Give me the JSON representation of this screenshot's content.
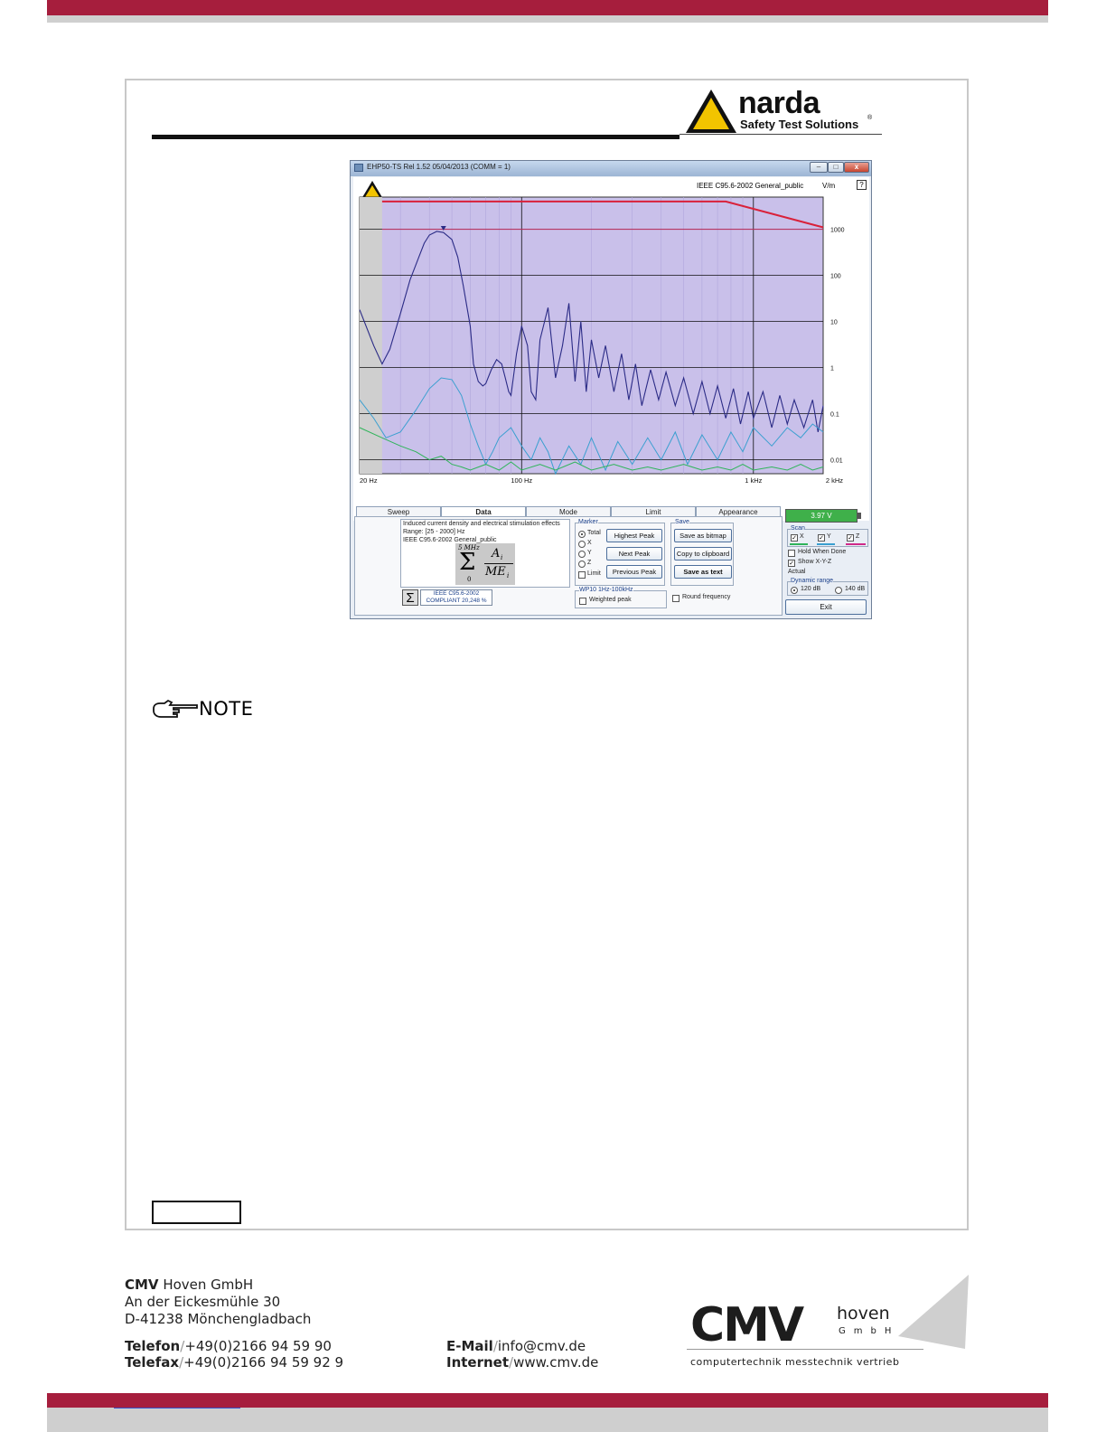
{
  "logo": {
    "brand": "narda",
    "tagline": "Safety Test Solutions",
    "registered": "®"
  },
  "app": {
    "title": "EHP50-TS Rel 1.52 05/04/2013 (COMM = 1)",
    "standard_label": "IEEE C95.6-2002 General_public",
    "unit": "V/m",
    "help": "?",
    "window_buttons": {
      "minimize": "–",
      "maximize": "□",
      "close": "x"
    },
    "tabs": [
      "Sweep",
      "Data",
      "Mode",
      "Limit",
      "Appearance"
    ],
    "active_tab": "Data",
    "battery": "3.97 V",
    "info": {
      "line1": "Induced current density and electrical stimulation effects",
      "line2": "Range: [25 - 2000] Hz",
      "line3": "IEEE C95.6-2002 General_public",
      "formula_sup": "5 MHz",
      "formula_sub": "0",
      "formula_num": "A",
      "formula_num_sub": "i",
      "formula_den": "ME",
      "formula_den_sub": "i",
      "sigma": "Σ",
      "compliance_line1": "IEEE C95.6-2002",
      "compliance_line2": "COMPLIANT 20,248 %"
    },
    "marker": {
      "title": "Marker",
      "options": [
        "Total",
        "X",
        "Y",
        "Z"
      ],
      "selected": "Total",
      "limit": "Limit",
      "buttons": [
        "Highest Peak",
        "Next Peak",
        "Previous Peak"
      ]
    },
    "save": {
      "title": "Save",
      "buttons": [
        "Save as bitmap",
        "Copy to clipboard",
        "Save as text"
      ]
    },
    "wp": {
      "title": "WP10 1Hz-100kHz",
      "weighted": "Weighted peak"
    },
    "round_frequency": "Round frequency",
    "scan": {
      "title": "Scan",
      "axes": [
        "X",
        "Y",
        "Z"
      ]
    },
    "hold_when_done": "Hold When Done",
    "show_xyz": "Show X-Y-Z",
    "actual": "Actual",
    "dynamic_range": {
      "title": "Dynamic range",
      "options": [
        "120 dB",
        "140 dB"
      ],
      "selected": "120 dB"
    },
    "exit": "Exit"
  },
  "chart_data": {
    "type": "line",
    "title": "IEEE C95.6-2002 General_public",
    "xlabel": "",
    "ylabel": "V/m",
    "x_scale": "log",
    "y_scale": "log",
    "xlim": [
      20,
      2000
    ],
    "ylim": [
      0.005,
      5000
    ],
    "x_ticks": [
      "20 Hz",
      "100 Hz",
      "1 kHz",
      "2 kHz"
    ],
    "y_ticks": [
      "1000",
      "100",
      "10",
      "1",
      "0.1",
      "0.01"
    ],
    "grid": true,
    "colors": {
      "total": "#2b2b86",
      "x": "#3a9fd0",
      "y": "#2fb45a",
      "limit": "#d9213a",
      "marker": "#2b2b86",
      "background": "#c9c0ea"
    },
    "series": [
      {
        "x": [
          20,
          23,
          25,
          27,
          30,
          33,
          36,
          38,
          40,
          43,
          46,
          50,
          53,
          56,
          60,
          62,
          65,
          68,
          70,
          74,
          78,
          82,
          85,
          88,
          90,
          95,
          100,
          106,
          110,
          115,
          120,
          130,
          140,
          150,
          160,
          170,
          180,
          190,
          200,
          215,
          230,
          250,
          270,
          290,
          310,
          330,
          360,
          390,
          420,
          460,
          500,
          550,
          600,
          650,
          700,
          760,
          820,
          880,
          950,
          1000,
          1100,
          1200,
          1300,
          1400,
          1500,
          1650,
          1800,
          1900,
          2000
        ],
        "values": [
          18,
          3,
          1.2,
          2.5,
          15,
          80,
          250,
          500,
          750,
          900,
          850,
          600,
          250,
          60,
          8,
          1.2,
          0.5,
          0.4,
          0.45,
          0.9,
          1.5,
          1.2,
          0.6,
          0.3,
          0.25,
          2,
          8,
          3,
          0.3,
          0.2,
          4,
          20,
          0.6,
          3,
          25,
          0.5,
          10,
          0.3,
          4,
          0.6,
          3,
          0.3,
          2,
          0.2,
          1.2,
          0.15,
          0.9,
          0.2,
          0.8,
          0.15,
          0.6,
          0.1,
          0.5,
          0.1,
          0.4,
          0.08,
          0.35,
          0.06,
          0.3,
          0.08,
          0.3,
          0.05,
          0.25,
          0.06,
          0.2,
          0.05,
          0.2,
          0.04,
          0.15
        ]
      },
      {
        "x": [
          20,
          23,
          26,
          30,
          35,
          40,
          45,
          50,
          55,
          60,
          65,
          70,
          75,
          80,
          90,
          100,
          110,
          120,
          130,
          140,
          160,
          180,
          200,
          230,
          260,
          300,
          350,
          400,
          460,
          520,
          600,
          700,
          800,
          900,
          1000,
          1200,
          1400,
          1600,
          1800,
          2000
        ],
        "values": [
          0.2,
          0.08,
          0.03,
          0.04,
          0.12,
          0.35,
          0.6,
          0.55,
          0.25,
          0.06,
          0.02,
          0.008,
          0.015,
          0.03,
          0.05,
          0.02,
          0.01,
          0.03,
          0.015,
          0.005,
          0.02,
          0.008,
          0.03,
          0.006,
          0.025,
          0.008,
          0.03,
          0.01,
          0.04,
          0.008,
          0.035,
          0.01,
          0.04,
          0.015,
          0.05,
          0.02,
          0.05,
          0.03,
          0.06,
          0.04
        ]
      },
      {
        "x": [
          20,
          25,
          30,
          35,
          40,
          45,
          50,
          55,
          60,
          70,
          80,
          90,
          100,
          120,
          140,
          170,
          200,
          250,
          300,
          350,
          400,
          500,
          600,
          700,
          800,
          900,
          1000,
          1200,
          1400,
          1600,
          1800,
          2000
        ],
        "values": [
          0.05,
          0.03,
          0.02,
          0.015,
          0.01,
          0.012,
          0.008,
          0.007,
          0.006,
          0.008,
          0.006,
          0.009,
          0.006,
          0.008,
          0.006,
          0.009,
          0.006,
          0.008,
          0.006,
          0.007,
          0.006,
          0.008,
          0.006,
          0.007,
          0.006,
          0.008,
          0.006,
          0.007,
          0.006,
          0.008,
          0.006,
          0.007
        ]
      },
      {
        "x": [
          25,
          760,
          2000
        ],
        "values": [
          4000,
          4000,
          1100
        ]
      },
      {
        "x": [
          25,
          2000
        ],
        "values": [
          1000,
          1000
        ]
      }
    ],
    "marker_point": {
      "x": 46,
      "y": 900
    }
  },
  "note": {
    "label": "NOTE"
  },
  "footer": {
    "company_bold": "CMV",
    "company_rest": " Hoven GmbH",
    "street": "An der Eickesmühle 30",
    "city": "D-41238 Mönchengladbach",
    "tel_label": "Telefon",
    "tel_value": "+49(0)2166 94 59 90",
    "fax_label": "Telefax",
    "fax_value": "+49(0)2166 94 59 92 9",
    "mail_label": "E-Mail",
    "mail_value": "info@cmv.de",
    "web_label": "Internet",
    "web_value": "www.cmv.de",
    "sep": "/",
    "logo_big": "CMV",
    "logo_hoven": "hoven",
    "logo_gmbh": "GmbH",
    "logo_tagline": "computertechnik messtechnik vertrieb"
  }
}
